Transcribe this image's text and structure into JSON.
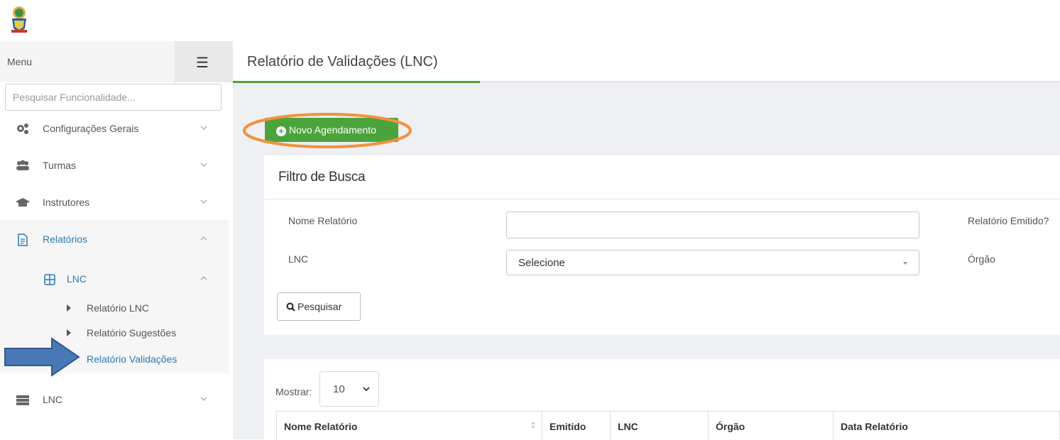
{
  "sidebar": {
    "menu_label": "Menu",
    "search_placeholder": "Pesquisar Funcionalidade...",
    "items": [
      {
        "label": "Configurações Gerais",
        "icon": "cogs-icon"
      },
      {
        "label": "Turmas",
        "icon": "users-icon"
      },
      {
        "label": "Instrutores",
        "icon": "graduation-cap-icon"
      },
      {
        "label": "Relatórios",
        "icon": "file-text-icon"
      },
      {
        "label": "LNC",
        "icon": "plus-square-icon"
      },
      {
        "label": "LNC",
        "icon": "server-icon"
      }
    ],
    "sub_items": [
      {
        "label": "Relatório LNC"
      },
      {
        "label": "Relatório Sugestões"
      },
      {
        "label": "Relatório Validações"
      }
    ]
  },
  "page": {
    "title": "Relatório de Validações (LNC)",
    "new_button": "Novo Agendamento"
  },
  "filter": {
    "title": "Filtro de Busca",
    "name_label": "Nome Relatório",
    "emitted_label": "Relatório Emitido?",
    "lnc_label": "LNC",
    "lnc_value": "Selecione",
    "orgao_label": "Órgão",
    "search_button": "Pesquisar"
  },
  "table": {
    "show_label": "Mostrar:",
    "page_length": "10",
    "columns": [
      "Nome Relatório",
      "Emitido",
      "LNC",
      "Órgão",
      "Data Relatório"
    ]
  },
  "colors": {
    "accent_green": "#4aa43b",
    "active_blue": "#2a7ab5",
    "highlight_orange": "#f0923c",
    "arrow_blue": "#4a78b5"
  }
}
